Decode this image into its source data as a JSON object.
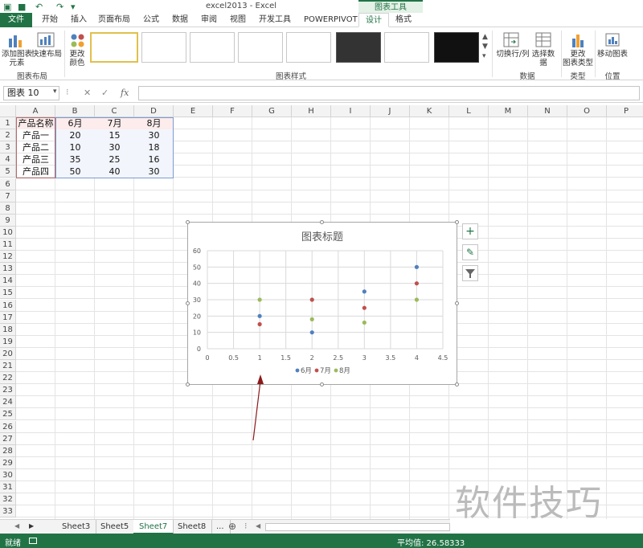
{
  "window": {
    "title": "excel2013 - Excel",
    "context_tools": "图表工具"
  },
  "tabs": [
    "文件",
    "开始",
    "插入",
    "页面布局",
    "公式",
    "数据",
    "审阅",
    "视图",
    "开发工具",
    "POWERPIVOT",
    "设计",
    "格式"
  ],
  "active_tab": "设计",
  "ribbon": {
    "add_element": "添加图表\n元素",
    "quick_layout": "快速布局",
    "chart_layout_group": "图表布局",
    "change_color": "更改\n颜色",
    "chart_styles_group": "图表样式",
    "switch_row_col": "切换行/列",
    "select_data": "选择数据",
    "data_group": "数据",
    "change_type": "更改\n图表类型",
    "type_group": "类型",
    "move_chart": "移动图表",
    "location_group": "位置"
  },
  "formula_bar": {
    "name_box": "图表 10",
    "cancel": "✕",
    "enter": "✓",
    "fx": "fx",
    "formula": ""
  },
  "columns": [
    "A",
    "B",
    "C",
    "D",
    "E",
    "F",
    "G",
    "H",
    "I",
    "J",
    "K",
    "L",
    "M",
    "N",
    "O",
    "P"
  ],
  "rows": [
    "1",
    "2",
    "3",
    "4",
    "5",
    "6",
    "7",
    "8",
    "9",
    "10",
    "11",
    "12",
    "13",
    "14",
    "15",
    "16",
    "17",
    "18",
    "19",
    "20",
    "21",
    "22",
    "23",
    "24",
    "25",
    "26",
    "27",
    "28",
    "29",
    "30",
    "31",
    "32",
    "33"
  ],
  "table": {
    "headers": [
      "产品名称",
      "6月",
      "7月",
      "8月"
    ],
    "rows": [
      [
        "产品一",
        "20",
        "15",
        "30"
      ],
      [
        "产品二",
        "10",
        "30",
        "18"
      ],
      [
        "产品三",
        "35",
        "25",
        "16"
      ],
      [
        "产品四",
        "50",
        "40",
        "30"
      ]
    ]
  },
  "chart_data": {
    "type": "scatter",
    "title": "图表标题",
    "xlim": [
      0,
      4.5
    ],
    "ylim": [
      0,
      60
    ],
    "x_ticks": [
      "0",
      "0.5",
      "1",
      "1.5",
      "2",
      "2.5",
      "3",
      "3.5",
      "4",
      "4.5"
    ],
    "y_ticks": [
      "0",
      "10",
      "20",
      "30",
      "40",
      "50",
      "60"
    ],
    "grid": true,
    "legend_position": "bottom",
    "series": [
      {
        "name": "6月",
        "color": "#4f81bd",
        "points": [
          [
            1,
            20
          ],
          [
            2,
            10
          ],
          [
            3,
            35
          ],
          [
            4,
            50
          ]
        ]
      },
      {
        "name": "7月",
        "color": "#c0504d",
        "points": [
          [
            1,
            15
          ],
          [
            2,
            30
          ],
          [
            3,
            25
          ],
          [
            4,
            40
          ]
        ]
      },
      {
        "name": "8月",
        "color": "#9bbb59",
        "points": [
          [
            1,
            30
          ],
          [
            2,
            18
          ],
          [
            3,
            16
          ],
          [
            4,
            30
          ]
        ]
      }
    ]
  },
  "sheet_tabs": [
    "Sheet3",
    "Sheet5",
    "Sheet7",
    "Sheet8",
    "..."
  ],
  "active_sheet": "Sheet7",
  "status": {
    "ready": "就绪",
    "average": "平均值: 26.58333"
  },
  "watermark": "软件技巧",
  "colors": {
    "accent": "#217346",
    "arrow": "#8b1a1a"
  }
}
